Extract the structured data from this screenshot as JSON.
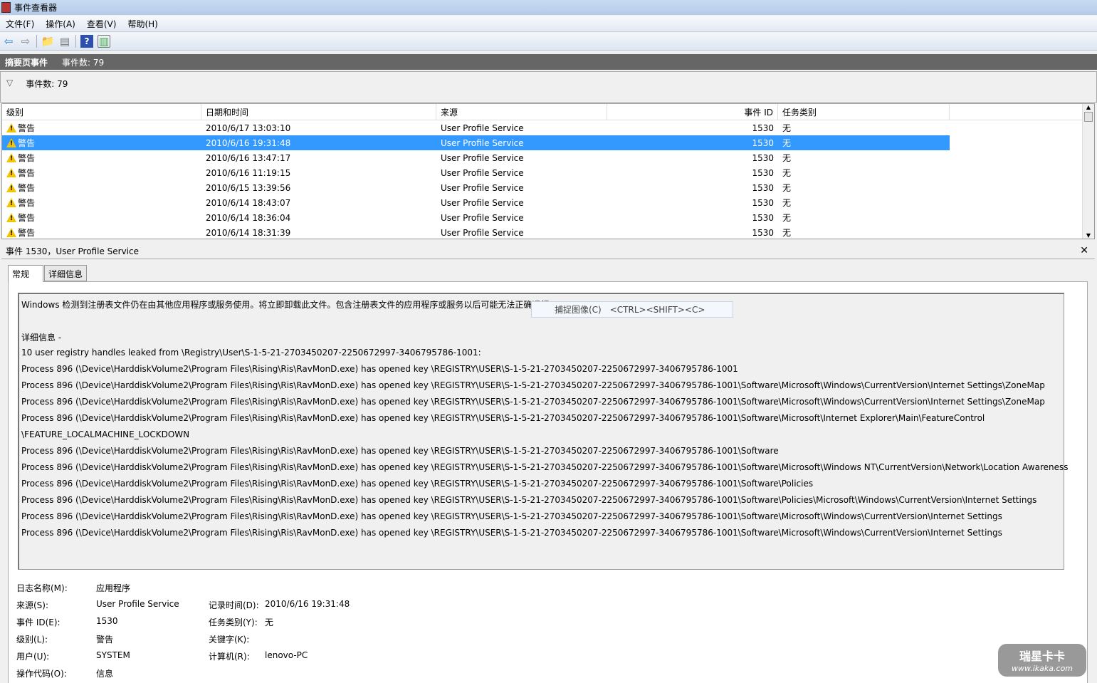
{
  "window": {
    "title": "事件查看器"
  },
  "menu": [
    "文件(F)",
    "操作(A)",
    "查看(V)",
    "帮助(H)"
  ],
  "summary": {
    "title": "摘要页事件",
    "count": "事件数: 79"
  },
  "filter": {
    "count": "事件数: 79"
  },
  "table": {
    "headers": [
      "级别",
      "日期和时间",
      "来源",
      "事件 ID",
      "任务类别"
    ],
    "rows": [
      [
        "警告",
        "2010/6/17 13:03:10",
        "User Profile Service",
        "1530",
        "无"
      ],
      [
        "警告",
        "2010/6/16 19:31:48",
        "User Profile Service",
        "1530",
        "无"
      ],
      [
        "警告",
        "2010/6/16 13:47:17",
        "User Profile Service",
        "1530",
        "无"
      ],
      [
        "警告",
        "2010/6/16 11:19:15",
        "User Profile Service",
        "1530",
        "无"
      ],
      [
        "警告",
        "2010/6/15 13:39:56",
        "User Profile Service",
        "1530",
        "无"
      ],
      [
        "警告",
        "2010/6/14 18:43:07",
        "User Profile Service",
        "1530",
        "无"
      ],
      [
        "警告",
        "2010/6/14 18:36:04",
        "User Profile Service",
        "1530",
        "无"
      ],
      [
        "警告",
        "2010/6/14 18:31:39",
        "User Profile Service",
        "1530",
        "无"
      ]
    ],
    "selected": 1
  },
  "detail": {
    "title": "事件 1530，User Profile Service",
    "close": "✕",
    "tabs": [
      "常规",
      "详细信息"
    ],
    "lines": [
      "Windows 检测到注册表文件仍在由其他应用程序或服务使用。将立即卸载此文件。包含注册表文件的应用程序或服务以后可能无法正确运行。",
      "",
      " 详细信息 -",
      " 10 user registry handles leaked from \\Registry\\User\\S-1-5-21-2703450207-2250672997-3406795786-1001:",
      "Process 896 (\\Device\\HarddiskVolume2\\Program Files\\Rising\\Ris\\RavMonD.exe) has opened key \\REGISTRY\\USER\\S-1-5-21-2703450207-2250672997-3406795786-1001",
      "Process 896 (\\Device\\HarddiskVolume2\\Program Files\\Rising\\Ris\\RavMonD.exe) has opened key \\REGISTRY\\USER\\S-1-5-21-2703450207-2250672997-3406795786-1001\\Software\\Microsoft\\Windows\\CurrentVersion\\Internet Settings\\ZoneMap",
      "Process 896 (\\Device\\HarddiskVolume2\\Program Files\\Rising\\Ris\\RavMonD.exe) has opened key \\REGISTRY\\USER\\S-1-5-21-2703450207-2250672997-3406795786-1001\\Software\\Microsoft\\Windows\\CurrentVersion\\Internet Settings\\ZoneMap",
      "Process 896 (\\Device\\HarddiskVolume2\\Program Files\\Rising\\Ris\\RavMonD.exe) has opened key \\REGISTRY\\USER\\S-1-5-21-2703450207-2250672997-3406795786-1001\\Software\\Microsoft\\Internet Explorer\\Main\\FeatureControl",
      "\\FEATURE_LOCALMACHINE_LOCKDOWN",
      "Process 896 (\\Device\\HarddiskVolume2\\Program Files\\Rising\\Ris\\RavMonD.exe) has opened key \\REGISTRY\\USER\\S-1-5-21-2703450207-2250672997-3406795786-1001\\Software",
      "Process 896 (\\Device\\HarddiskVolume2\\Program Files\\Rising\\Ris\\RavMonD.exe) has opened key \\REGISTRY\\USER\\S-1-5-21-2703450207-2250672997-3406795786-1001\\Software\\Microsoft\\Windows NT\\CurrentVersion\\Network\\Location Awareness",
      "Process 896 (\\Device\\HarddiskVolume2\\Program Files\\Rising\\Ris\\RavMonD.exe) has opened key \\REGISTRY\\USER\\S-1-5-21-2703450207-2250672997-3406795786-1001\\Software\\Policies",
      "Process 896 (\\Device\\HarddiskVolume2\\Program Files\\Rising\\Ris\\RavMonD.exe) has opened key \\REGISTRY\\USER\\S-1-5-21-2703450207-2250672997-3406795786-1001\\Software\\Policies\\Microsoft\\Windows\\CurrentVersion\\Internet Settings",
      "Process 896 (\\Device\\HarddiskVolume2\\Program Files\\Rising\\Ris\\RavMonD.exe) has opened key \\REGISTRY\\USER\\S-1-5-21-2703450207-2250672997-3406795786-1001\\Software\\Microsoft\\Windows\\CurrentVersion\\Internet Settings",
      "Process 896 (\\Device\\HarddiskVolume2\\Program Files\\Rising\\Ris\\RavMonD.exe) has opened key \\REGISTRY\\USER\\S-1-5-21-2703450207-2250672997-3406795786-1001\\Software\\Microsoft\\Windows\\CurrentVersion\\Internet Settings"
    ],
    "tooltip": {
      "label": "捕捉图像(C)",
      "shortcut": "<CTRL><SHIFT><C>"
    },
    "fields": {
      "log_name": {
        "label": "日志名称(M):",
        "value": "应用程序"
      },
      "source": {
        "label": "来源(S):",
        "value": "User Profile Service"
      },
      "logged": {
        "label": "记录时间(D):",
        "value": "2010/6/16 19:31:48"
      },
      "event_id": {
        "label": "事件 ID(E):",
        "value": "1530"
      },
      "task": {
        "label": "任务类别(Y):",
        "value": "无"
      },
      "level": {
        "label": "级别(L):",
        "value": "警告"
      },
      "keywords": {
        "label": "关键字(K):",
        "value": ""
      },
      "user": {
        "label": "用户(U):",
        "value": "SYSTEM"
      },
      "computer": {
        "label": "计算机(R):",
        "value": "lenovo-PC"
      },
      "opcode": {
        "label": "操作代码(O):",
        "value": "信息"
      }
    }
  },
  "watermark": {
    "line1": "瑞星卡卡",
    "line2": "www.ikaka.com"
  }
}
